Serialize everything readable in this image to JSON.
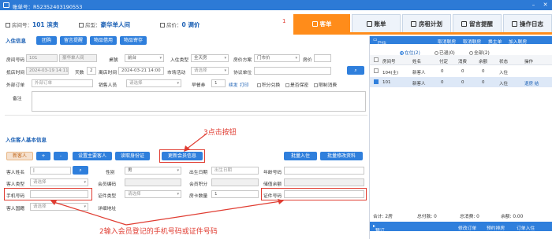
{
  "window": {
    "title": "账单号：R52352403190553"
  },
  "info": {
    "room_label": "房间号",
    "room_value": "101 滨贵",
    "type_label": "房型",
    "type_value": "豪华单人间",
    "price_label": "房价",
    "price_value": "0 调价"
  },
  "marker_1": "1",
  "tabs": [
    {
      "label": "客单"
    },
    {
      "label": "账单"
    },
    {
      "label": "房租计划"
    },
    {
      "label": "留言提醒"
    },
    {
      "label": "操作日志"
    }
  ],
  "checkin": {
    "title": "入住信息",
    "buttons": [
      "团购",
      "留言提醒",
      "物品借用",
      "物品寄存"
    ],
    "fields": {
      "room_no_label": "房间号码",
      "room_no": "101",
      "room_type": "豪华单人间",
      "table_label": "桌號",
      "table_value": "前台",
      "checkin_type_label": "入住类型",
      "checkin_type": "全天房",
      "price_plan_label": "房价方案",
      "price_plan": "门市价",
      "room_price_label": "房价",
      "arrive_label": "抵店时间",
      "arrive": "2024-03-19 14:11",
      "days_label": "天数",
      "days": "2",
      "leave_label": "离店时间",
      "leave": "2024-03-21 14:00",
      "market_label": "市场活动",
      "market": "请选择",
      "agreement_label": "协议单位",
      "outer_label": "外部订单",
      "outer": "外部订单",
      "seller_label": "销售人员",
      "seller": "请选择",
      "cards_label": "早餐券",
      "cards_value": "1",
      "renew": "续发",
      "print": "打印",
      "opt1": "积分兑换",
      "opt2": "是否保密",
      "opt3": "限制消费",
      "remark_label": "备注"
    }
  },
  "guest": {
    "title": "入住客人基本信息",
    "btn_new": "新客人",
    "btn_plus": "+",
    "btn_minus": "-",
    "btn_main": "设置主要客人",
    "btn_idcard": "读取身份证",
    "btn_member": "更新会员信息",
    "btn_batch_checkin": "批量入住",
    "btn_batch_edit": "批量修改资料",
    "fields": {
      "name_label": "客人姓名",
      "name_value": "|",
      "gender_label": "性别",
      "gender": "男",
      "birth_label": "出生日期",
      "birth": "出生日期",
      "age_label": "年龄号码",
      "gtype_label": "客人类型",
      "gtype": "请选择",
      "member_code_label": "会员编码",
      "points_label": "会员积分",
      "balance_label": "储值余额",
      "phone_label": "手机号码",
      "id_type_label": "证件类型",
      "id_type": "请选择",
      "cards_num_label": "房卡数量",
      "cards_num": "1",
      "id_no_label": "证件号码",
      "nation_label": "客人国籍",
      "nation": "请选择",
      "address_label": "详细地址"
    }
  },
  "annotations": {
    "step3": "3点击按钮",
    "step2": "2输入会员登记的手机号码或证件号码"
  },
  "right": {
    "header": {
      "title": "已住",
      "links": [
        "取消联房",
        "取消联房",
        "换主单",
        "加入联房"
      ]
    },
    "filters": [
      {
        "label": "在住(2)",
        "checked": true
      },
      {
        "label": "已退(0)",
        "checked": false
      },
      {
        "label": "全部(2)",
        "checked": false
      }
    ],
    "columns": [
      "房间号",
      "姓名",
      "付定",
      "消费",
      "余额",
      "状态",
      "操作"
    ],
    "rows": [
      {
        "room": "104(主)",
        "name": "新客人",
        "deposit": "0",
        "spend": "0",
        "balance": "0",
        "status": "入住",
        "ops": "",
        "checked": false
      },
      {
        "room": "101",
        "name": "新客人",
        "deposit": "0",
        "spend": "0",
        "balance": "0",
        "status": "入住",
        "ops": "退房 结",
        "checked": true
      }
    ],
    "footer": {
      "count": "合计: 2房",
      "deposit": "总付款: 0",
      "spend": "总消费: 0",
      "balance": "余额: 0.00"
    },
    "bar": {
      "prev": "预订",
      "edit": "修改订单",
      "pre_sched": "预约排房",
      "checkin": "订单入住"
    }
  }
}
